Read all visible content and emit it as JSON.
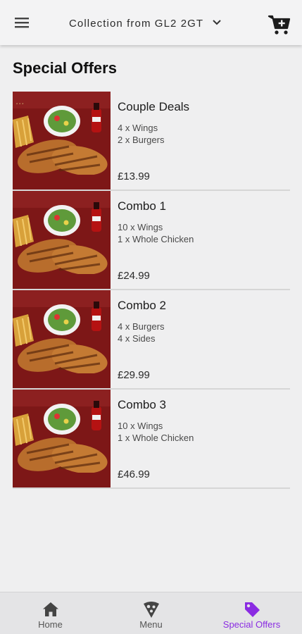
{
  "header": {
    "location_label": "Collection from GL2 2GT",
    "menu_icon": "hamburger-menu-icon",
    "dropdown_icon": "chevron-down-icon",
    "cart_icon": "cart-add-icon"
  },
  "page": {
    "title": "Special Offers"
  },
  "offers": [
    {
      "name": "Couple Deals",
      "line1": "4 x Wings",
      "line2": "2 x Burgers",
      "price": "£13.99"
    },
    {
      "name": "Combo 1",
      "line1": "10 x Wings",
      "line2": "1 x Whole Chicken",
      "price": "£24.99"
    },
    {
      "name": "Combo 2",
      "line1": "4 x Burgers",
      "line2": "4 x Sides",
      "price": "£29.99"
    },
    {
      "name": "Combo 3",
      "line1": "10 x Wings",
      "line2": "1 x Whole Chicken",
      "price": "£46.99"
    }
  ],
  "bottom_nav": {
    "items": [
      {
        "label": "Home",
        "icon": "home-icon"
      },
      {
        "label": "Menu",
        "icon": "pizza-slice-icon"
      },
      {
        "label": "Special Offers",
        "icon": "tag-icon"
      }
    ],
    "active_index": 2
  },
  "colors": {
    "accent": "#8a2be2",
    "inactive_icon": "#444444",
    "image_background": "#7d1717"
  }
}
